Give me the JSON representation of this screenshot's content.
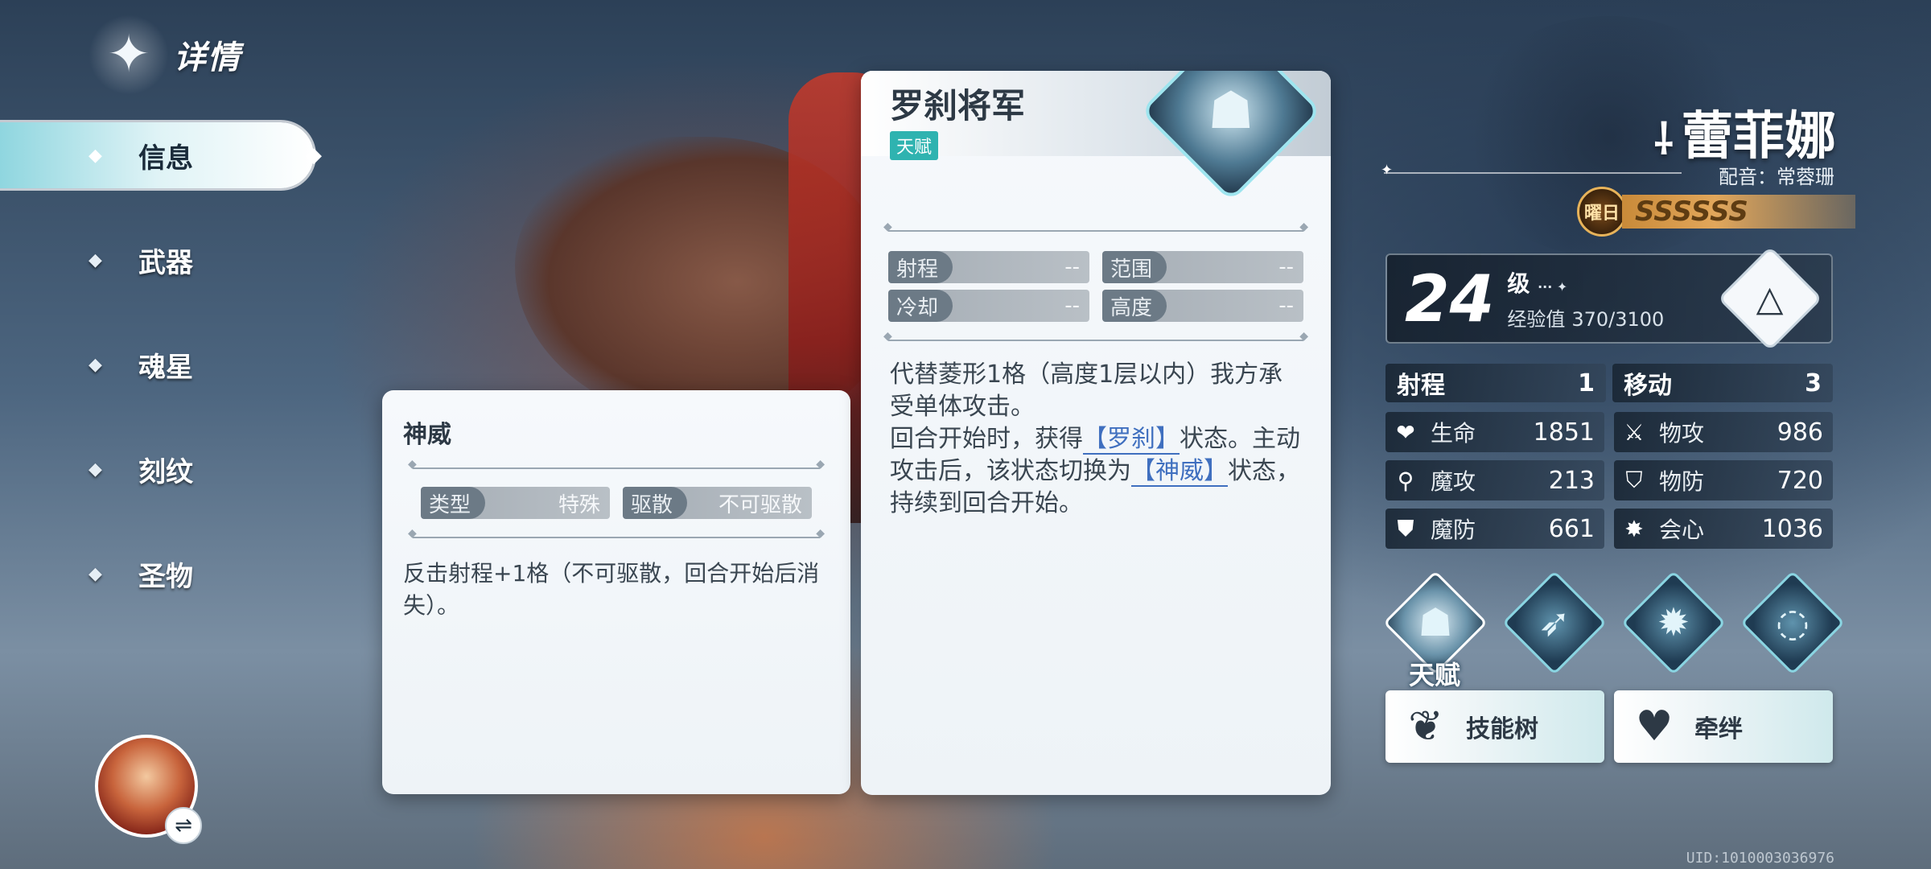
{
  "header": {
    "title": "详情"
  },
  "nav": {
    "items": [
      {
        "label": "信息",
        "active": true
      },
      {
        "label": "武器"
      },
      {
        "label": "魂星"
      },
      {
        "label": "刻纹"
      },
      {
        "label": "圣物"
      }
    ]
  },
  "side_card": {
    "title": "神威",
    "attrs": [
      {
        "k": "类型",
        "v": "特殊"
      },
      {
        "k": "驱散",
        "v": "不可驱散"
      }
    ],
    "desc": "反击射程+1格（不可驱散，回合开始后消失）。"
  },
  "main_card": {
    "title": "罗刹将军",
    "tag": "天赋",
    "attrs": [
      {
        "k": "射程",
        "v": "--"
      },
      {
        "k": "范围",
        "v": "--"
      },
      {
        "k": "冷却",
        "v": "--"
      },
      {
        "k": "高度",
        "v": "--"
      }
    ],
    "desc_line1": "代替菱形1格（高度1层以内）我方承受单体攻击。",
    "desc_line2_pre": "回合开始时，获得",
    "desc_kw1": "【罗刹】",
    "desc_line2_mid": "状态。主动攻击后，该状态切换为",
    "desc_kw2": "【神威】",
    "desc_line2_post": "状态，持续到回合开始。"
  },
  "character": {
    "name": "蕾菲娜",
    "voice_label": "配音：",
    "voice_actor": "常蓉珊",
    "rank_badge": "曜日",
    "rank_marks": "SSSSSS",
    "level": "24",
    "level_unit": "级",
    "exp_label": "经验值",
    "exp_value": "370/3100",
    "level_progress": 0.119,
    "range_label": "射程",
    "range_value": "1",
    "move_label": "移动",
    "move_value": "3",
    "stats": [
      {
        "k": "生命",
        "v": "1851",
        "icon": "heart-icon"
      },
      {
        "k": "物攻",
        "v": "986",
        "icon": "sword-icon"
      },
      {
        "k": "魔攻",
        "v": "213",
        "icon": "wand-icon"
      },
      {
        "k": "物防",
        "v": "720",
        "icon": "shield-icon"
      },
      {
        "k": "魔防",
        "v": "661",
        "icon": "magic-shield-icon"
      },
      {
        "k": "会心",
        "v": "1036",
        "icon": "crit-icon"
      }
    ],
    "skills": [
      {
        "label": "天赋",
        "icon": "wolf-mask-icon",
        "active": true
      },
      {
        "icon": "slash-icon"
      },
      {
        "icon": "dragon-icon"
      },
      {
        "icon": "vortex-icon"
      }
    ],
    "buttons": [
      {
        "label": "技能树",
        "icon": "tree-icon"
      },
      {
        "label": "牵绊",
        "icon": "heart-crest-icon"
      }
    ]
  },
  "uid": "UID:1010003036976"
}
